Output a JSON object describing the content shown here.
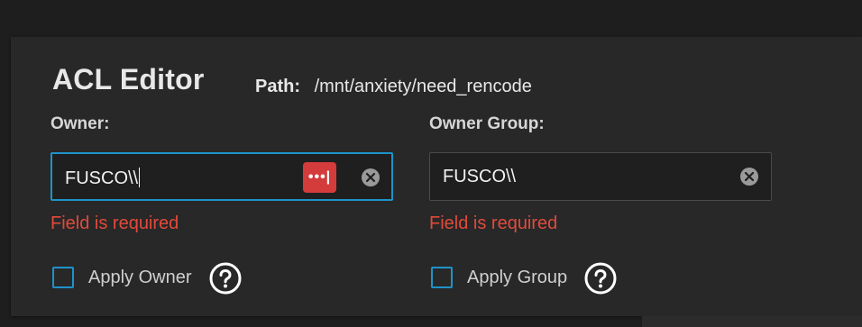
{
  "dialog": {
    "title": "ACL Editor",
    "path_label": "Path:",
    "path_value": "/mnt/anxiety/need_rencode"
  },
  "owner": {
    "label": "Owner:",
    "value": "FUSCO\\\\",
    "error": "Field is required",
    "apply_label": "Apply Owner",
    "apply_checked": false,
    "password_manager_icon": "password-manager-icon",
    "clear_icon": "clear-icon",
    "help_icon": "help-icon"
  },
  "owner_group": {
    "label": "Owner Group:",
    "value": "FUSCO\\\\",
    "error": "Field is required",
    "apply_label": "Apply Group",
    "apply_checked": false,
    "clear_icon": "clear-icon",
    "help_icon": "help-icon"
  },
  "colors": {
    "accent": "#1e93c9",
    "error": "#e24a3b",
    "password_manager": "#d43b3b",
    "card_background": "#282828",
    "page_background": "#1e1e1e"
  }
}
